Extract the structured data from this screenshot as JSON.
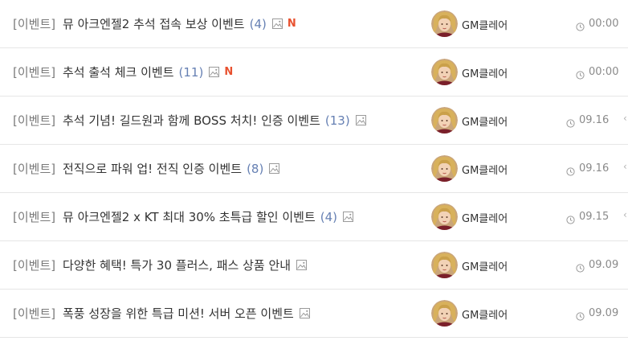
{
  "posts": [
    {
      "category": "[이벤트]",
      "title": "뮤 아크엔젤2 추석 접속 보상 이벤트",
      "count": "(4)",
      "has_image": true,
      "new_badge": "N",
      "author": "GM클레어",
      "time": "00:00",
      "edge_arrow": ""
    },
    {
      "category": "[이벤트]",
      "title": "추석 출석 체크 이벤트",
      "count": "(11)",
      "has_image": true,
      "new_badge": "N",
      "author": "GM클레어",
      "time": "00:00",
      "edge_arrow": ""
    },
    {
      "category": "[이벤트]",
      "title": "추석 기념! 길드원과 함께 BOSS 처치! 인증 이벤트",
      "count": "(13)",
      "has_image": true,
      "new_badge": "",
      "author": "GM클레어",
      "time": "09.16",
      "edge_arrow": "‹"
    },
    {
      "category": "[이벤트]",
      "title": "전직으로 파워 업! 전직 인증 이벤트",
      "count": "(8)",
      "has_image": true,
      "new_badge": "",
      "author": "GM클레어",
      "time": "09.16",
      "edge_arrow": "‹"
    },
    {
      "category": "[이벤트]",
      "title": "뮤 아크엔젤2 x KT 최대 30% 초특급 할인 이벤트",
      "count": "(4)",
      "has_image": true,
      "new_badge": "",
      "author": "GM클레어",
      "time": "09.15",
      "edge_arrow": "‹"
    },
    {
      "category": "[이벤트]",
      "title": "다양한 혜택! 특가 30 플러스, 패스 상품 안내",
      "count": "",
      "has_image": true,
      "new_badge": "",
      "author": "GM클레어",
      "time": "09.09",
      "edge_arrow": ""
    },
    {
      "category": "[이벤트]",
      "title": "폭풍 성장을 위한 특급 미션! 서버 오픈 이벤트",
      "count": "",
      "has_image": true,
      "new_badge": "",
      "author": "GM클레어",
      "time": "09.09",
      "edge_arrow": ""
    }
  ],
  "icons": {
    "attachment": "image-icon",
    "time": "clock-icon",
    "author_avatar": "avatar"
  },
  "colors": {
    "category": "#7a7a7a",
    "title": "#333333",
    "count": "#6680b3",
    "new_badge": "#e8512f",
    "divider": "#e6e6e6"
  }
}
